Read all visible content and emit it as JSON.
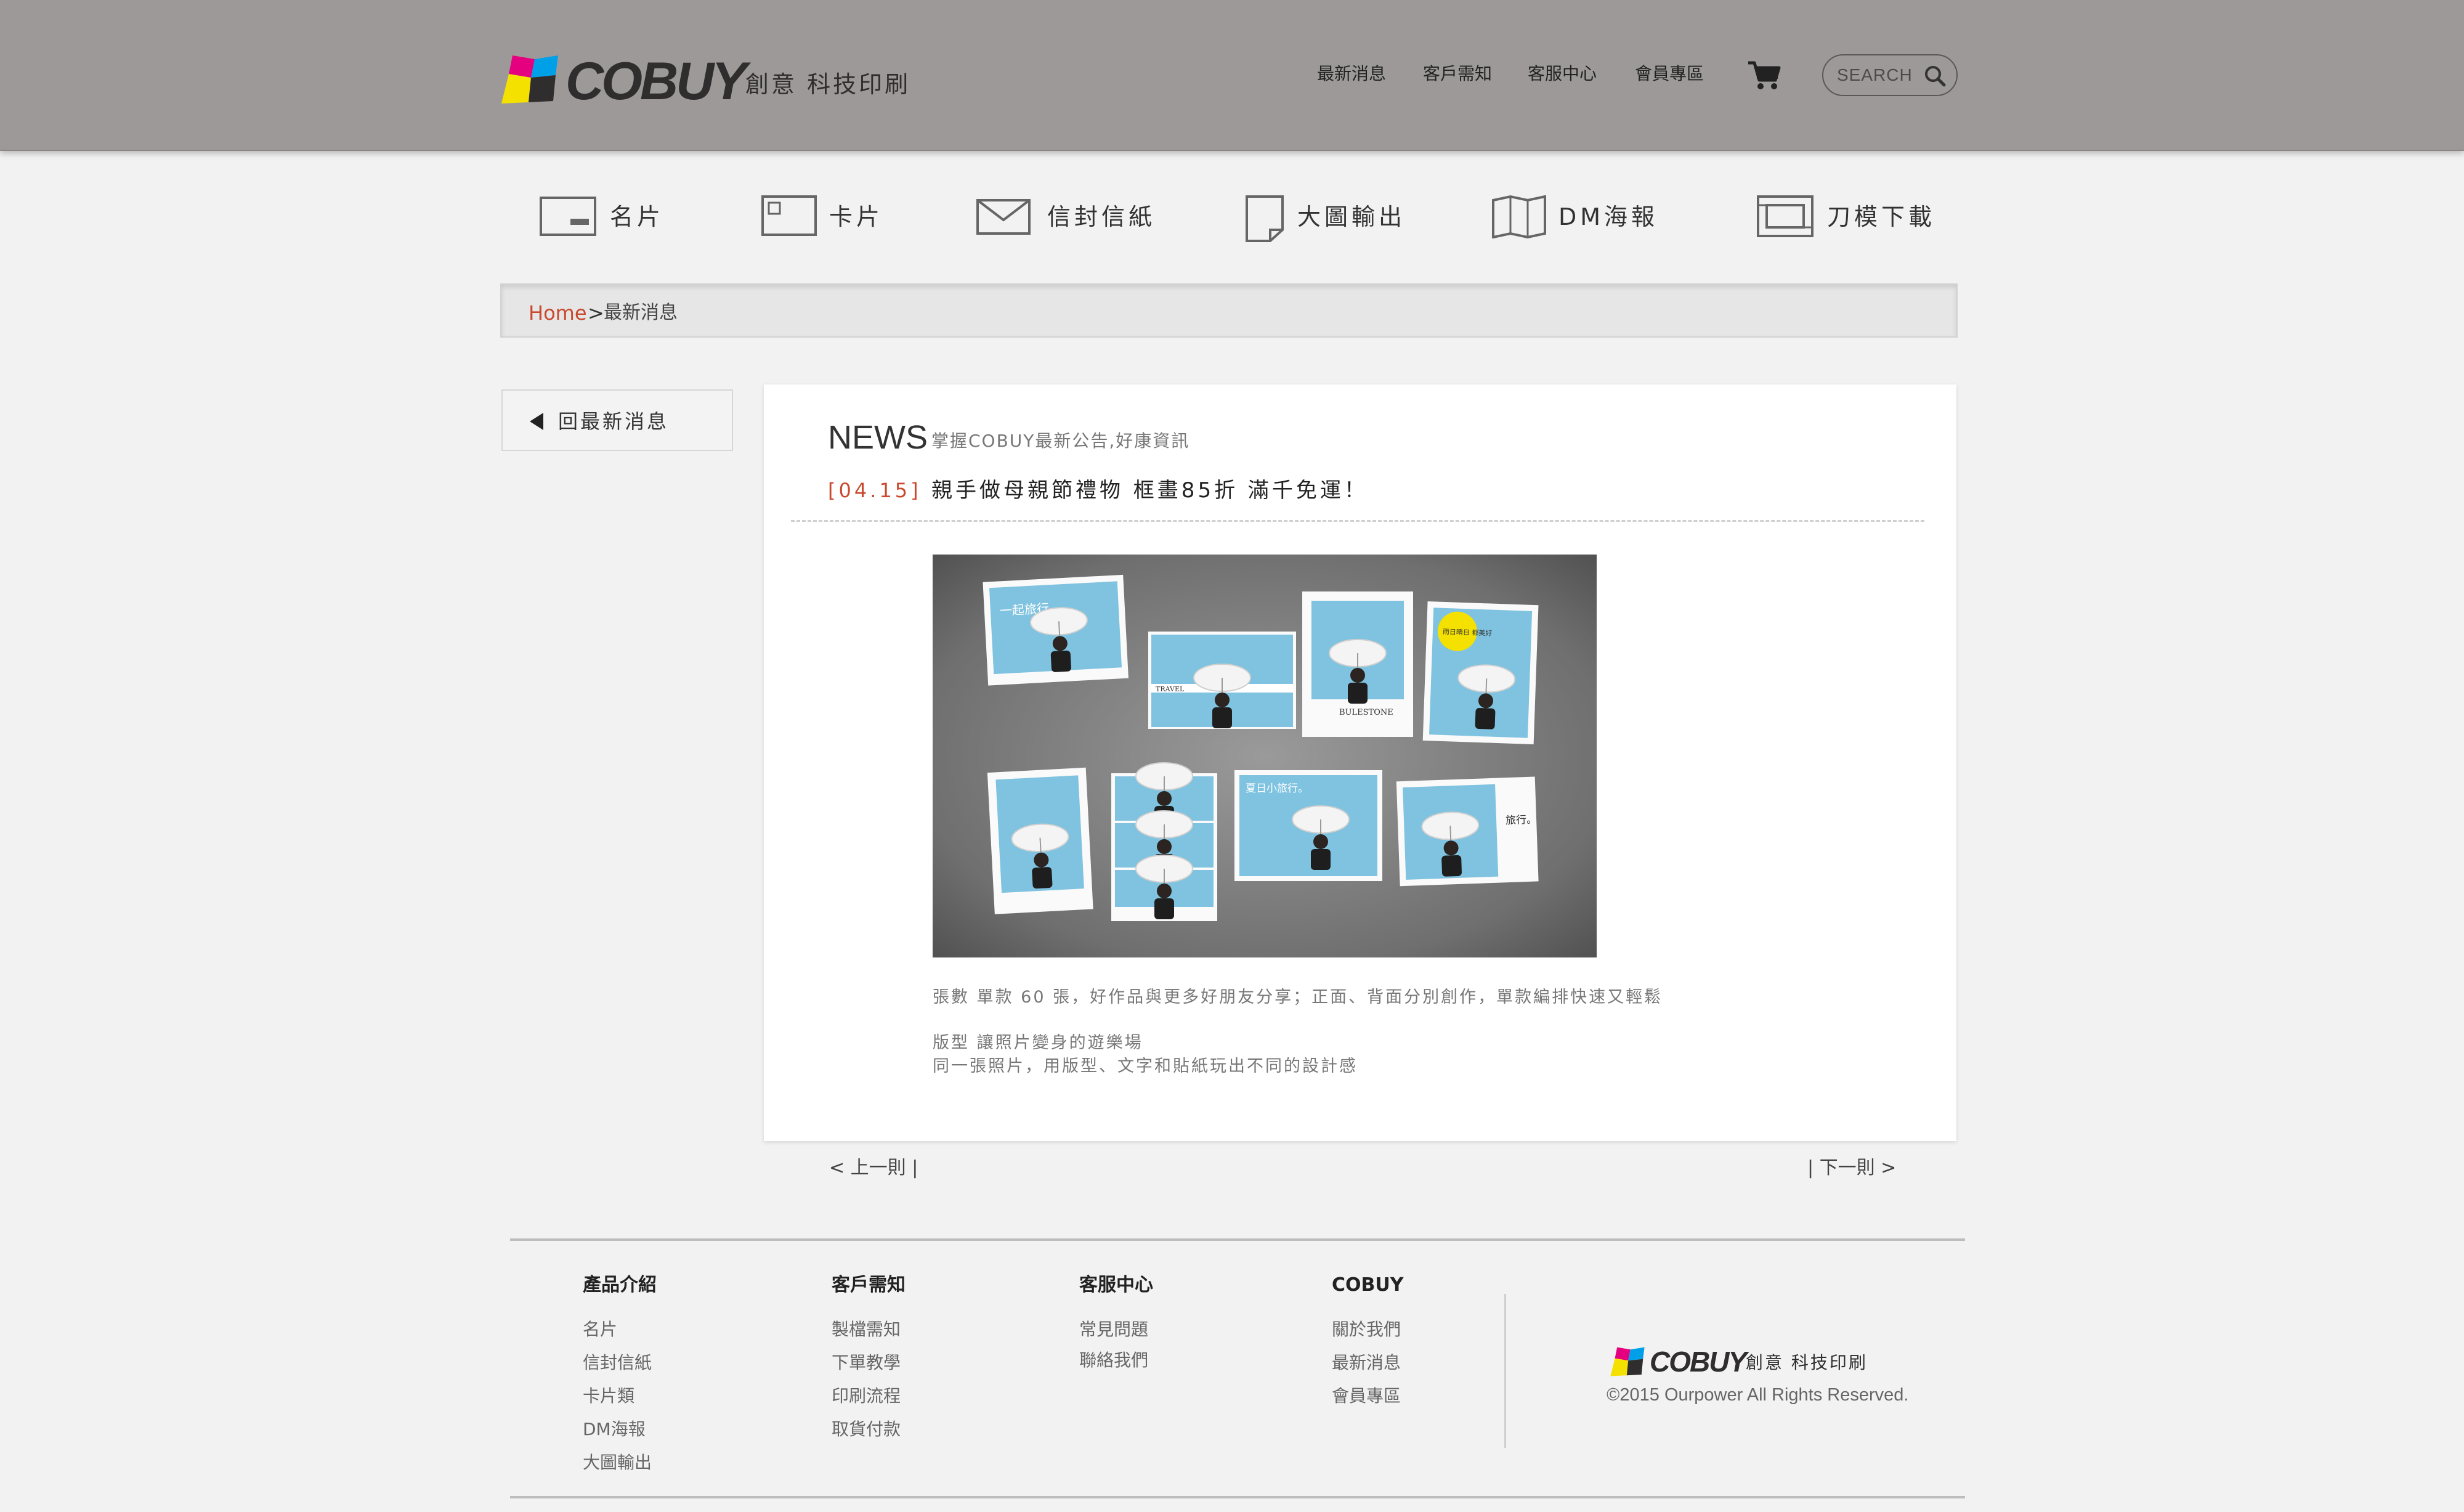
{
  "header": {
    "logo_text": "COBUY",
    "logo_tagline": "創意 科技印刷",
    "nav": [
      "最新消息",
      "客戶需知",
      "客服中心",
      "會員專區"
    ],
    "search_placeholder": "SEARCH"
  },
  "categories": [
    "名片",
    "卡片",
    "信封信紙",
    "大圖輸出",
    "DM海報",
    "刀模下載"
  ],
  "breadcrumb": {
    "home": "Home",
    "separator": ">",
    "current": "最新消息"
  },
  "sidebar": {
    "back_label": "回最新消息"
  },
  "news": {
    "title": "NEWS",
    "subtitle": "掌握COBUY最新公告,好康資訊",
    "date": "[04.15]",
    "headline": "親手做母親節禮物 框畫85折 滿千免運！",
    "description": [
      "張數 單款 60 張，好作品與更多好朋友分享；正面、背面分別創作，單款編排快速又輕鬆",
      "版型 讓照片變身的遊樂場",
      "同一張照片，用版型、文字和貼紙玩出不同的設計感"
    ],
    "photo_texts": {
      "card1": "一起旅行。",
      "card2": "TRAVEL",
      "card3": "BULESTONE",
      "card4": "雨日晴日 都美好",
      "card7": "夏日小旅行。",
      "card8": "旅行。"
    }
  },
  "pager": {
    "prev": "< 上一則 |",
    "next": "| 下一則 >"
  },
  "footer": {
    "columns": [
      {
        "title": "產品介紹",
        "links": [
          "名片",
          "信封信紙",
          "卡片類",
          "DM海報",
          "大圖輸出"
        ]
      },
      {
        "title": "客戶需知",
        "links": [
          "製檔需知",
          "下單教學",
          "印刷流程",
          "取貨付款"
        ]
      },
      {
        "title": "客服中心",
        "links": [
          "常見問題",
          "聯絡我們"
        ]
      },
      {
        "title": "COBUY",
        "links": [
          "關於我們",
          "最新消息",
          "會員專區"
        ]
      }
    ],
    "logo_text": "COBUY",
    "logo_tagline": "創意 科技印刷",
    "copyright": "©2015 Ourpower All Rights Reserved."
  },
  "colors": {
    "header_bg": "#9d9999",
    "page_bg": "#f2f2f2",
    "accent_red": "#c9492e",
    "logo_magenta": "#e4007f",
    "logo_cyan": "#00a0e9",
    "logo_yellow": "#f5e100",
    "logo_black": "#2f2d2d"
  },
  "icons": {
    "cart": "shopping-cart-icon",
    "search": "magnifier-icon",
    "back": "triangle-left-icon"
  }
}
